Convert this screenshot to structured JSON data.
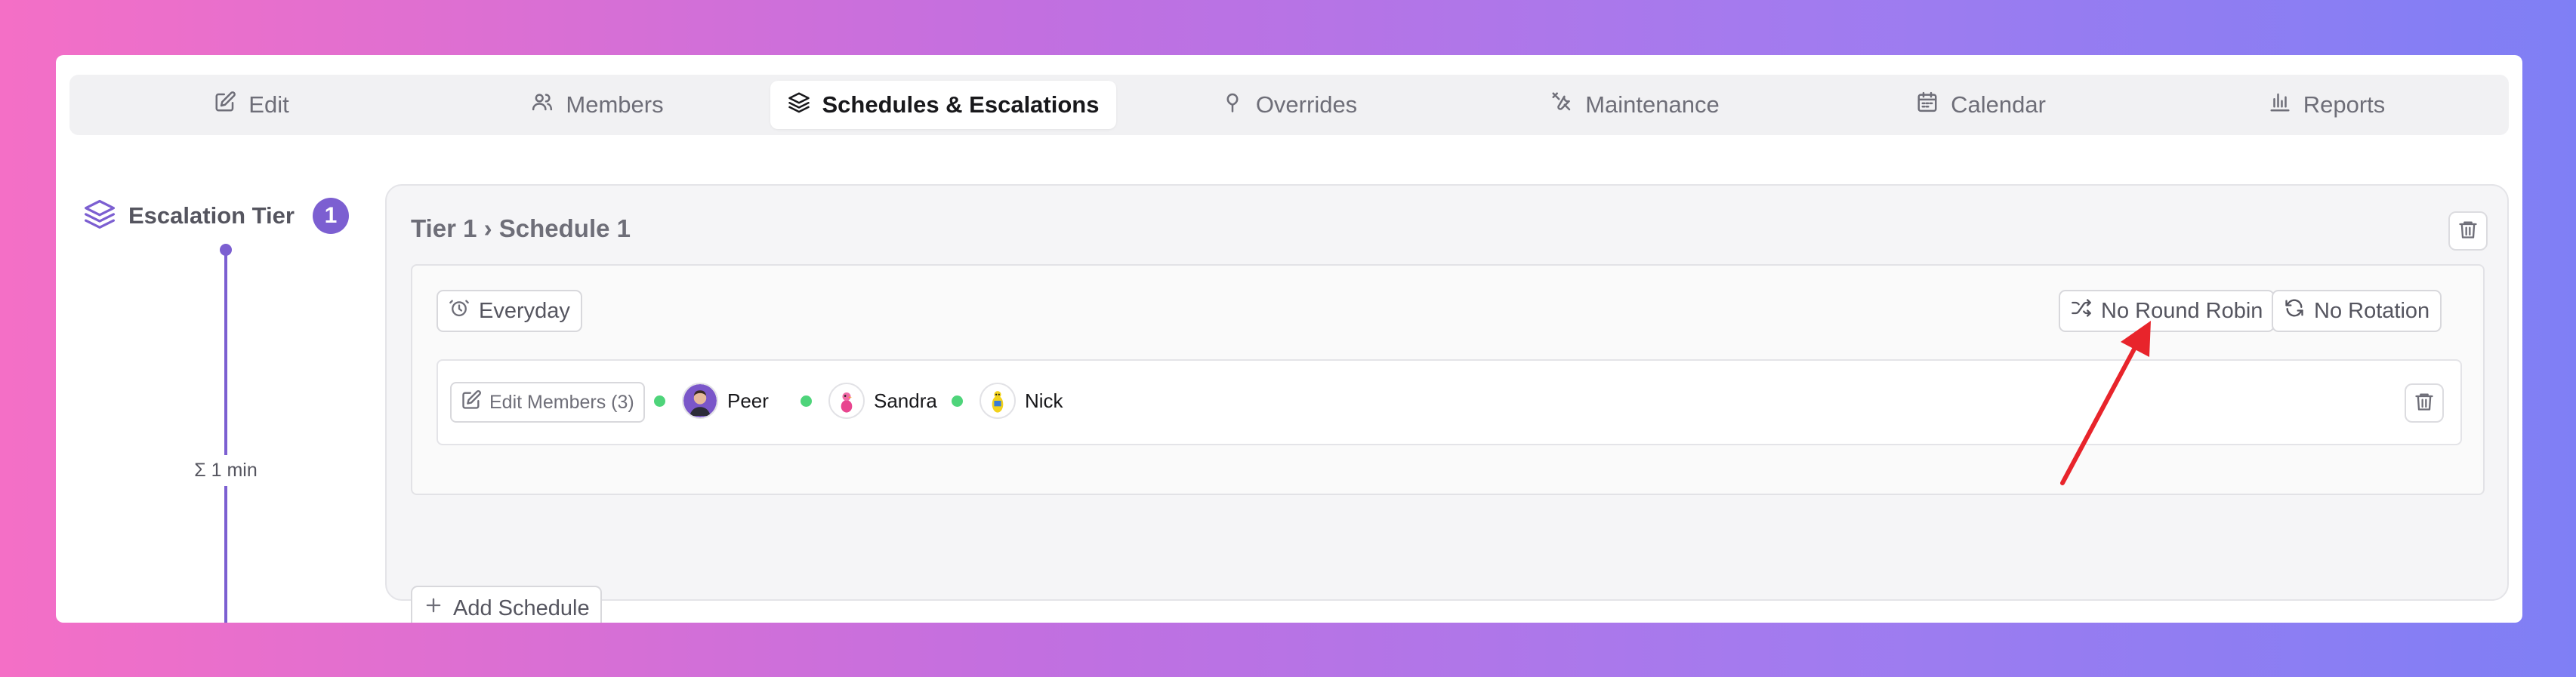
{
  "tabs": [
    {
      "label": "Edit",
      "icon": "edit-icon",
      "active": false
    },
    {
      "label": "Members",
      "icon": "users-icon",
      "active": false
    },
    {
      "label": "Schedules & Escalations",
      "icon": "layers-icon",
      "active": true
    },
    {
      "label": "Overrides",
      "icon": "pin-icon",
      "active": false
    },
    {
      "label": "Maintenance",
      "icon": "tools-icon",
      "active": false
    },
    {
      "label": "Calendar",
      "icon": "calendar-icon",
      "active": false
    },
    {
      "label": "Reports",
      "icon": "bar-chart-icon",
      "active": false
    }
  ],
  "escalation": {
    "title": "Escalation Tier",
    "tier_number": "1",
    "duration": "Σ 1 min"
  },
  "tier_card": {
    "title": "Tier 1 › Schedule 1",
    "schedule": {
      "days_label": "Everyday",
      "round_robin_label": "No Round Robin",
      "rotation_label": "No Rotation",
      "edit_members_label": "Edit Members (3)",
      "members": [
        {
          "name": "Peer",
          "status": "online"
        },
        {
          "name": "Sandra",
          "status": "online"
        },
        {
          "name": "Nick",
          "status": "online"
        }
      ]
    },
    "add_schedule_label": "Add Schedule"
  },
  "colors": {
    "accent": "#7c5fd1",
    "online": "#4ed47a",
    "annotation_arrow": "#e8242b"
  }
}
